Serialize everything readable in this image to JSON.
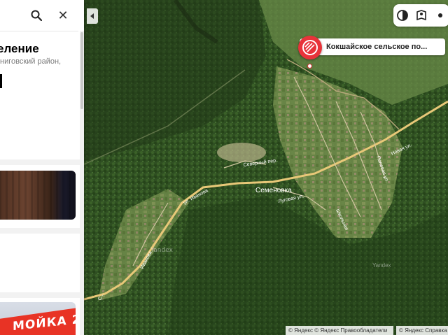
{
  "sidebar": {
    "title": "еление",
    "subtitle": "ниговский район,",
    "photo_sign_text": "МОЙКА 2"
  },
  "map": {
    "marker_label": "Кокшайское сельское по...",
    "labels": {
      "village": "Семеновка",
      "street_severny": "Северный пер.",
      "street_lugovaya": "Луговая ул.",
      "street_novaya": "Новая ул.",
      "street_polevaya": "Полевая ул.",
      "street_ivanova": "ул. Иванова",
      "street_ivanova_v": "Иванова",
      "street_s": "С...",
      "street_shkolnaya": "Школьная"
    },
    "watermark": "Yandex",
    "attribution": {
      "left": "© Яндекс © Яндекс",
      "terms_link": "Правообладатели",
      "right": "© Яндекс",
      "help_link": "Справка"
    }
  },
  "colors": {
    "marker": "#e8333a",
    "road": "#e8c878",
    "sidebar_bg": "#ffffff"
  },
  "icons": {
    "search": "search-icon",
    "close": "close-icon",
    "collapse": "chevron-left-icon",
    "layers": "layers-icon",
    "panorama": "panorama-icon",
    "marker": "stripes-marker-icon"
  }
}
